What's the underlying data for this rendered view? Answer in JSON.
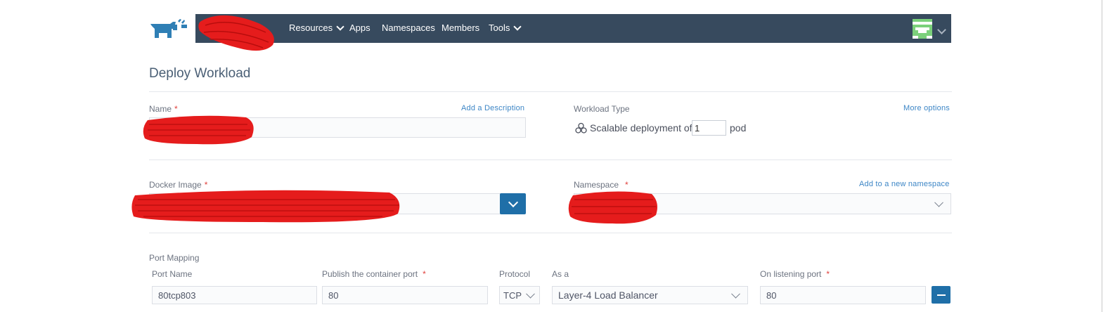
{
  "navbar": {
    "items": [
      {
        "label": "Resources",
        "dropdown": true
      },
      {
        "label": "Apps",
        "dropdown": false
      },
      {
        "label": "Namespaces",
        "dropdown": false
      },
      {
        "label": "Members",
        "dropdown": false
      },
      {
        "label": "Tools",
        "dropdown": true
      }
    ],
    "background": "#374a5e",
    "icons": [
      "rancher-logo-icon",
      "user-avatar-icon",
      "chevron-down-icon"
    ]
  },
  "page": {
    "title": "Deploy Workload"
  },
  "name_section": {
    "label": "Name",
    "add_description_link": "Add a Description",
    "value": ""
  },
  "workload_type": {
    "label": "Workload Type",
    "more_options_link": "More options",
    "text": "Scalable deployment of",
    "pod_count": "1",
    "unit": "pod"
  },
  "docker_image": {
    "label": "Docker Image",
    "value": ""
  },
  "namespace": {
    "label": "Namespace",
    "add_namespace_link": "Add to a new namespace",
    "value": ""
  },
  "port_mapping": {
    "title": "Port Mapping",
    "headers": {
      "port_name": "Port Name",
      "publish_port": "Publish the container port",
      "protocol": "Protocol",
      "as_a": "As a",
      "listening_port": "On listening port"
    },
    "rows": [
      {
        "port_name": "80tcp803",
        "publish_port": "80",
        "protocol": "TCP",
        "as_a": "Layer-4 Load Balancer",
        "listening_port": "80"
      }
    ]
  },
  "colors": {
    "accent_button": "#1f6fa8",
    "link": "#3d86c6",
    "required": "#e0413d",
    "redaction": "#e51c1c"
  }
}
